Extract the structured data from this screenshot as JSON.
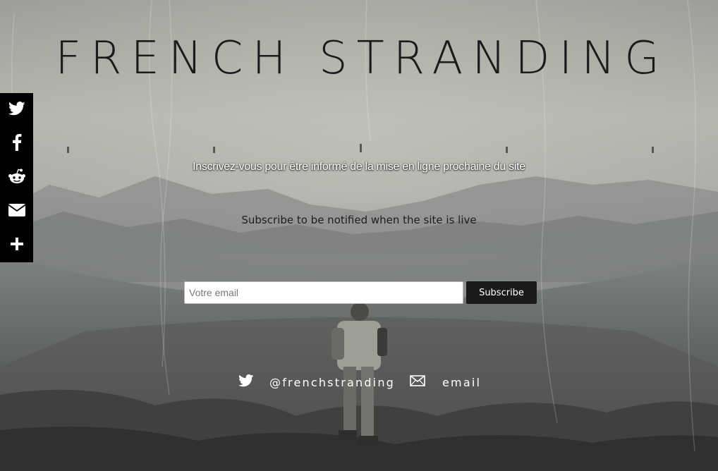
{
  "page": {
    "title": "FRENCH STRANDING",
    "subtitle_fr": "Inscrivez-vous pour être informé de la mise en ligne prochaine du site",
    "subtitle_en": "Subscribe to be notified when the site is live"
  },
  "form": {
    "email_placeholder": "Votre email",
    "email_value": "",
    "subscribe_label": "Subscribe"
  },
  "social": {
    "twitter_label": "@frenchstranding",
    "twitter_icon": "twitter-bird-icon",
    "email_label": "email",
    "email_icon": "envelope-icon"
  },
  "share_bar": {
    "items": [
      {
        "icon": "twitter-icon"
      },
      {
        "icon": "facebook-icon"
      },
      {
        "icon": "reddit-icon"
      },
      {
        "icon": "email-icon"
      },
      {
        "icon": "plus-icon"
      }
    ]
  },
  "colors": {
    "title": "#1b1b1b",
    "share_bar": "#000000",
    "button": "#1a1a1a"
  }
}
